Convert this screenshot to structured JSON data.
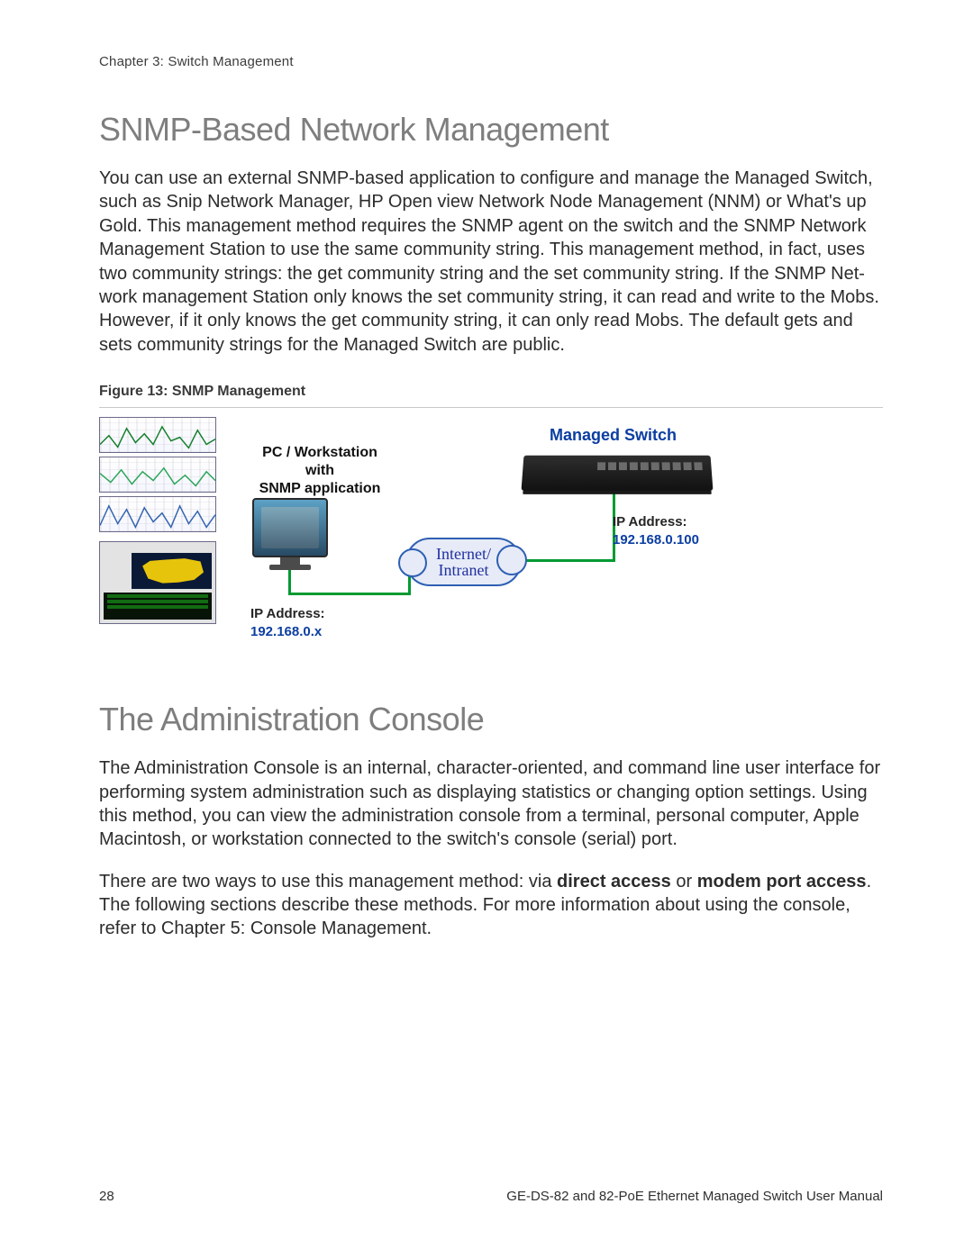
{
  "header": {
    "chapter": "Chapter 3: Switch Management"
  },
  "section1": {
    "title": "SNMP-Based Network Management",
    "paragraph": "You can use an external SNMP-based application to configure and manage the Managed Switch, such as Snip Network Manager, HP Open view Network Node Management (NNM) or What's up Gold. This management method requires the SNMP agent on the switch and the SNMP Network Management Station to use the same community string. This management method, in fact, uses two community strings: the get community string and the set community string. If the SNMP Net-work management Station only knows the set community string, it can read and write to the Mobs. However, if it only knows the get community string, it can only read Mobs. The default gets and sets community strings for the Managed Switch are public."
  },
  "figure": {
    "caption": "Figure 13: SNMP Management",
    "pc_label_l1": "PC / Workstation",
    "pc_label_l2": "with",
    "pc_label_l3": "SNMP application",
    "pc_ip_label": "IP Address:",
    "pc_ip_value": "192.168.0.x",
    "cloud_l1": "Internet/",
    "cloud_l2": "Intranet",
    "switch_title": "Managed Switch",
    "switch_ip_label": "IP Address:",
    "switch_ip_value": "192.168.0.100"
  },
  "section2": {
    "title": "The Administration Console",
    "paragraph1": "The Administration Console is an internal, character-oriented, and command line user interface for performing system administration such as displaying statistics or changing option settings. Using this method, you can view the administration console from a terminal, personal computer, Apple Macintosh, or workstation connected to the switch's console (serial) port.",
    "p2_a": "There are two ways to use this management method: via ",
    "p2_b": "direct access",
    "p2_c": " or ",
    "p2_d": "modem port access",
    "p2_e": ". The following sections describe these methods. For more information about using the console, refer to Chapter 5:  Console Management."
  },
  "footer": {
    "page": "28",
    "manual": "GE-DS-82 and 82-PoE Ethernet Managed Switch User Manual"
  }
}
